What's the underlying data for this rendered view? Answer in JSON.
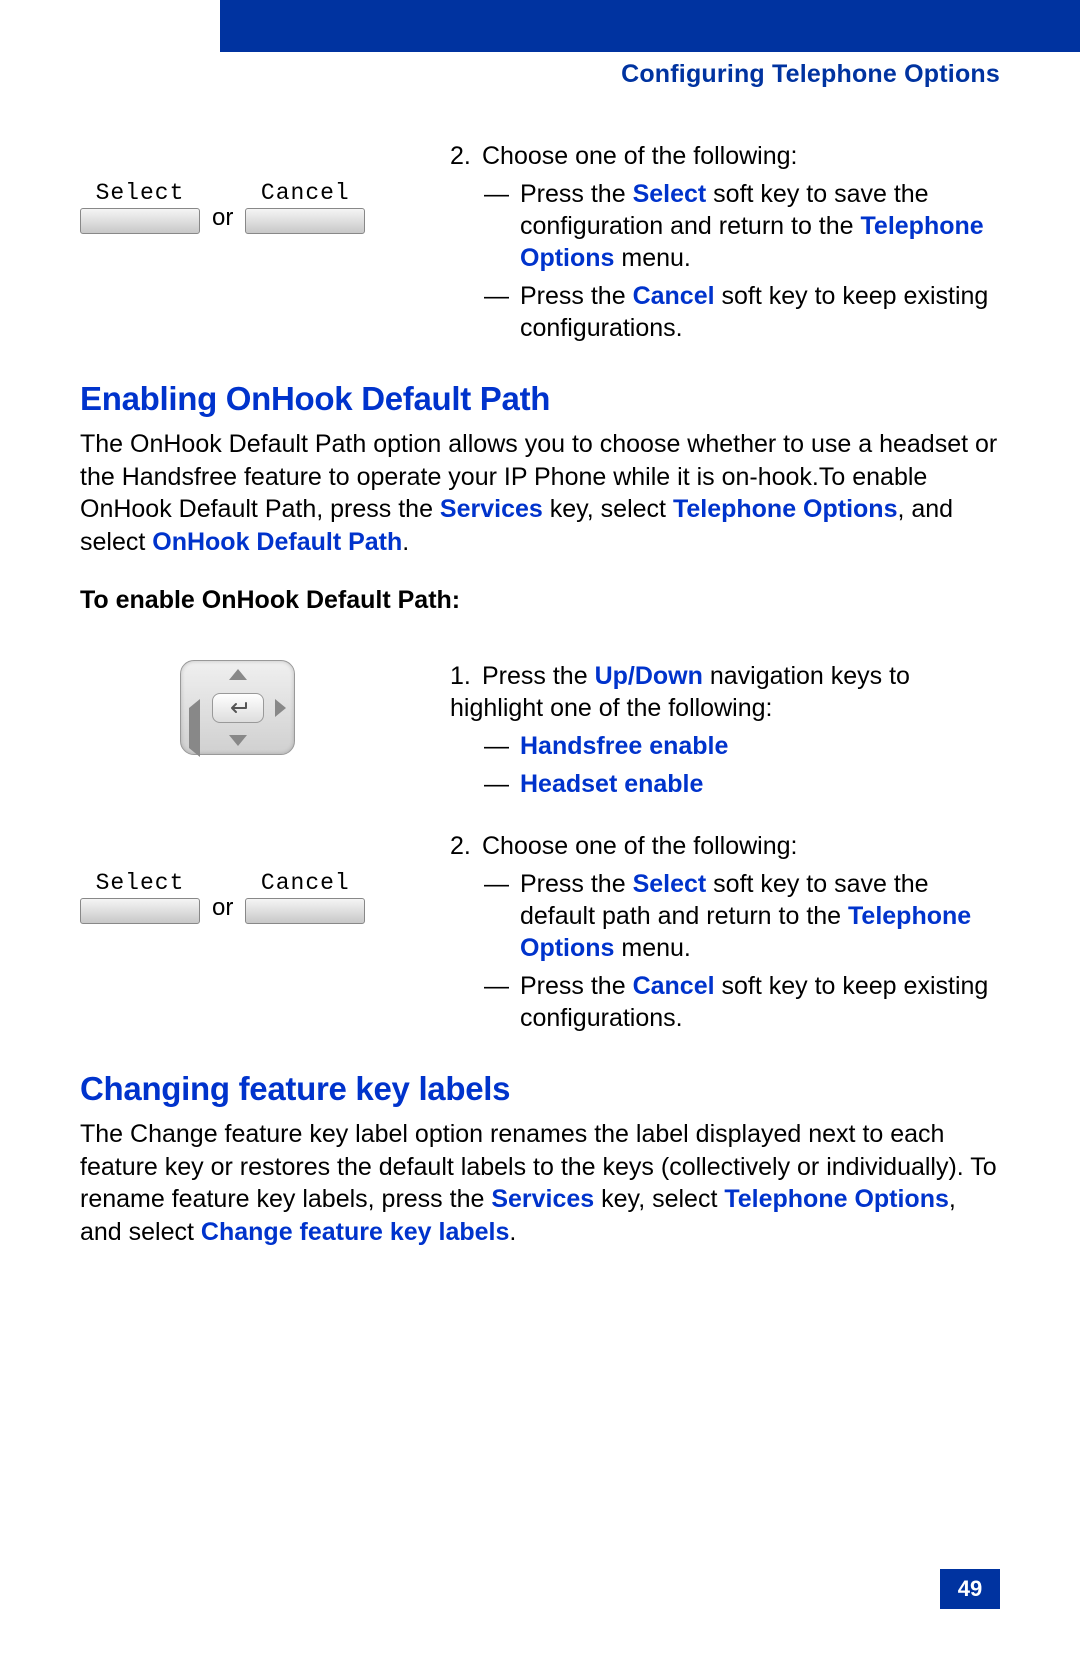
{
  "header": {
    "title": "Configuring Telephone Options"
  },
  "softkeys": {
    "select": "Select",
    "cancel": "Cancel",
    "or": "or"
  },
  "step2a": {
    "num": "2.",
    "lead": "Choose one of the following:",
    "opt1_pre": "Press the ",
    "opt1_key": "Select",
    "opt1_mid": " soft key to save the configuration and return to the ",
    "opt1_link": "Telephone Options",
    "opt1_post": " menu.",
    "opt2_pre": "Press the ",
    "opt2_key": "Cancel",
    "opt2_post": " soft key to keep existing configurations."
  },
  "section1": {
    "heading": "Enabling OnHook Default Path",
    "para_pre": "The OnHook Default Path option allows you to choose whether to use a headset or the Handsfree feature to operate your IP Phone while it is on-hook.To enable OnHook Default Path, press the ",
    "services": "Services",
    "para_mid1": " key, select ",
    "telopt": "Telephone Options",
    "para_mid2": ", and select ",
    "onhook": "OnHook Default Path",
    "para_end": ".",
    "subhead": "To enable OnHook Default Path:"
  },
  "step1b": {
    "num": "1.",
    "lead_pre": "Press the ",
    "updown": "Up/Down",
    "lead_post": " navigation keys to highlight one of the following:",
    "opt1": "Handsfree enable",
    "opt2": "Headset enable"
  },
  "step2b": {
    "num": "2.",
    "lead": "Choose one of the following:",
    "opt1_pre": "Press the ",
    "opt1_key": "Select",
    "opt1_mid": " soft key to save the default path and return to the ",
    "opt1_link": "Telephone Options",
    "opt1_post": " menu.",
    "opt2_pre": "Press the ",
    "opt2_key": "Cancel",
    "opt2_post": " soft key to keep existing configurations."
  },
  "section2": {
    "heading": "Changing feature key labels",
    "para_pre": "The Change feature key label option renames the label displayed next to each feature key or restores the default labels to the keys (collectively or individually). To rename feature key labels, press the ",
    "services": "Services",
    "para_mid1": " key, select ",
    "telopt": "Telephone Options",
    "para_mid2": ", and select ",
    "change": "Change feature key labels",
    "para_end": "."
  },
  "page": {
    "number": "49"
  }
}
